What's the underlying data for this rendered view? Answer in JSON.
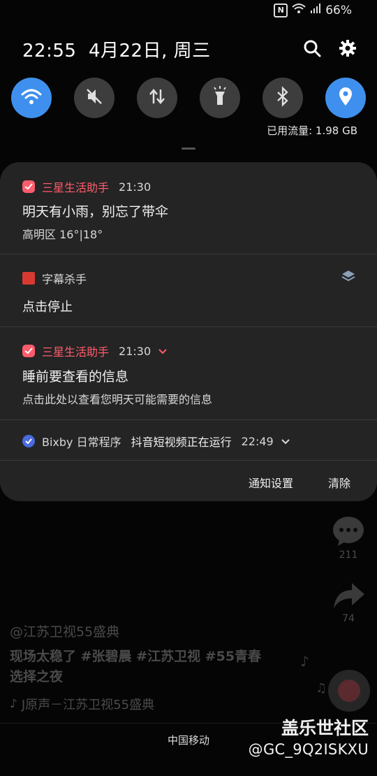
{
  "status_bar": {
    "battery": "66%",
    "icons": [
      "nfc-icon",
      "wifi-icon",
      "signal-icon"
    ]
  },
  "header": {
    "time": "22:55",
    "date": "4月22日, 周三"
  },
  "quick_toggles": [
    {
      "name": "wifi",
      "icon": "wifi-icon",
      "on": true
    },
    {
      "name": "sound",
      "icon": "mute-icon",
      "on": false
    },
    {
      "name": "mobile-data",
      "icon": "data-arrows-icon",
      "on": false
    },
    {
      "name": "flashlight",
      "icon": "flashlight-icon",
      "on": false
    },
    {
      "name": "bluetooth",
      "icon": "bluetooth-icon",
      "on": false
    },
    {
      "name": "location",
      "icon": "location-icon",
      "on": true
    }
  ],
  "data_usage": "已用流量: 1.98 GB",
  "notifications": [
    {
      "app": "三星生活助手",
      "time": "21:30",
      "title": "明天有小雨，别忘了带伞",
      "text": "高明区 16°|18°",
      "accent": "#ff5c6c"
    },
    {
      "app": "字幕杀手",
      "title": "点击停止"
    },
    {
      "app": "三星生活助手",
      "time": "21:30",
      "title": "睡前要查看的信息",
      "text": "点击此处以查看您明天可能需要的信息",
      "accent": "#ff5c6c"
    },
    {
      "app": "Bixby 日常程序",
      "title": "抖音短视频正在运行",
      "time": "22:49"
    }
  ],
  "actions": {
    "settings": "通知设置",
    "clear": "清除"
  },
  "background": {
    "comments": "211",
    "shares": "74",
    "author": "@江苏卫视55盛典",
    "desc1": "现场太稳了 #张碧晨 #江苏卫视 #55青春",
    "desc2": "选择之夜",
    "music": "J原声－江苏卫视55盛典"
  },
  "carrier": "中国移动",
  "watermark": {
    "line1": "盖乐世社区",
    "line2": "@GC_9Q2ISKXU"
  },
  "colors": {
    "accent_blue": "#3f90ee",
    "panel": "#242424",
    "toggle_off": "#3d3d3d",
    "alert_red": "#ff5c6c"
  }
}
